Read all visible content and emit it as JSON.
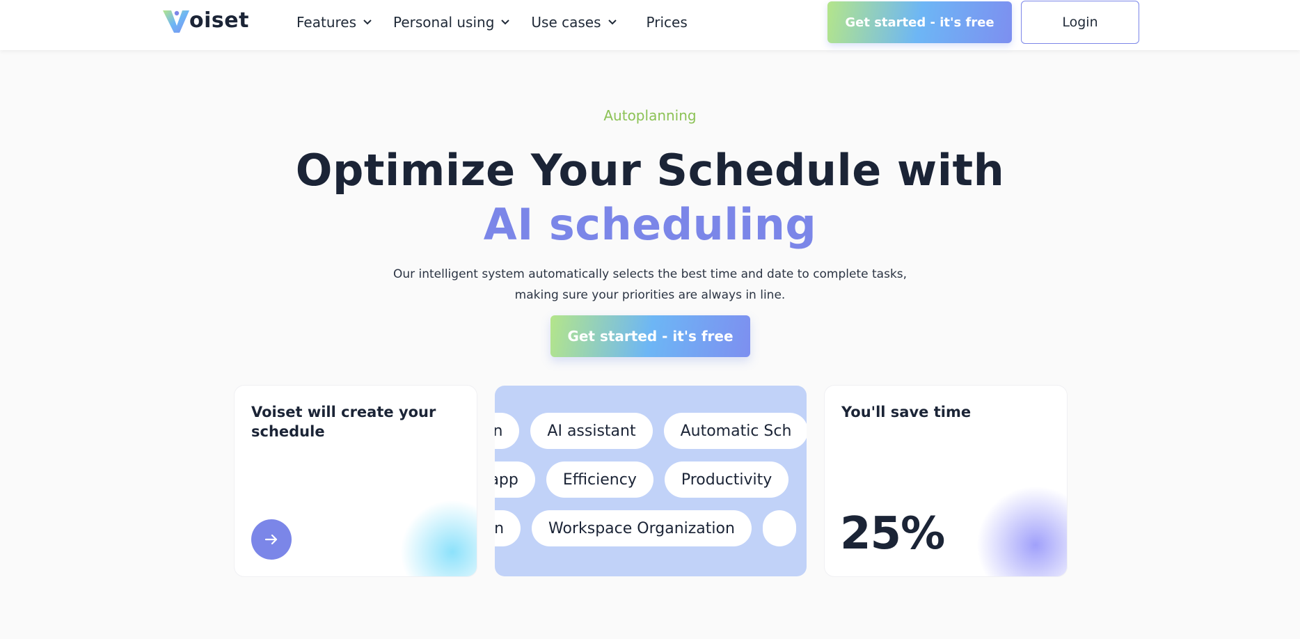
{
  "header": {
    "brand": "Voiset",
    "brand_suffix": "oiset",
    "nav": [
      {
        "label": "Features",
        "dropdown": true
      },
      {
        "label": "Personal using",
        "dropdown": true
      },
      {
        "label": "Use cases",
        "dropdown": true
      },
      {
        "label": "Prices",
        "dropdown": false
      }
    ],
    "cta_label": "Get started - it's free",
    "login_label": "Login"
  },
  "hero": {
    "eyebrow": "Autoplanning",
    "headline_line1": "Optimize Your Schedule with",
    "headline_accent": "AI scheduling",
    "subtext_line1": "Our intelligent system automatically selects the best time and date to complete tasks,",
    "subtext_line2": "making sure your priorities are always in line.",
    "cta_label": "Get started - it's free"
  },
  "cards": {
    "left": {
      "title": "Voiset will create your schedule",
      "arrow_icon": "arrow-right-icon"
    },
    "middle": {
      "rows": [
        [
          "on",
          "AI assistant",
          "Automatic Sch"
        ],
        [
          "o app",
          "Efficiency",
          "Productivity"
        ],
        [
          "esign",
          "Workspace Organization",
          ""
        ]
      ]
    },
    "right": {
      "title": "You'll save time",
      "stat": "25%"
    }
  },
  "colors": {
    "accent": "#7b86e8",
    "eyebrow": "#8cc256",
    "text_dark": "#1b2436",
    "tag_panel": "#c1d2f8"
  }
}
